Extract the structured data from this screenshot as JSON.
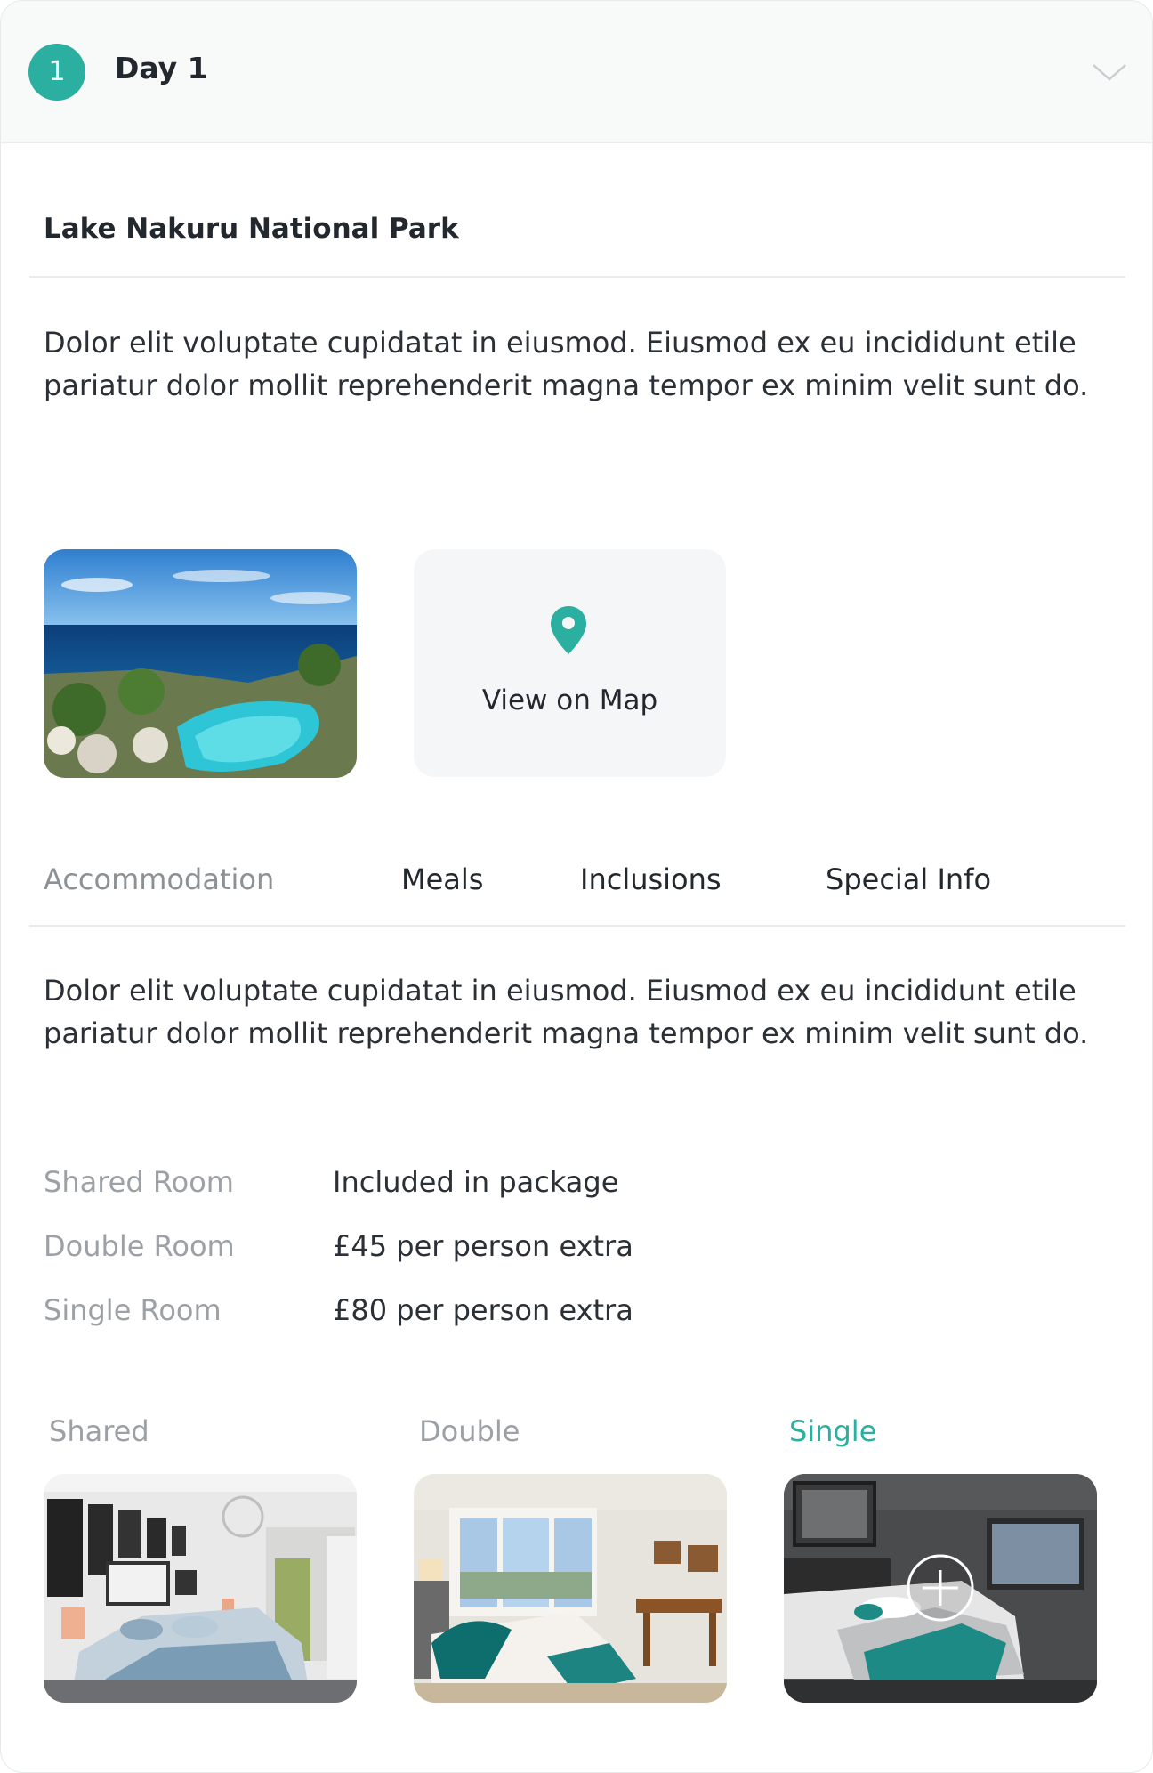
{
  "header": {
    "day_number": "1",
    "title": "Day 1"
  },
  "location": {
    "title": "Lake Nakuru National Park",
    "description": "Dolor elit voluptate cupidatat in eiusmod. Eiusmod ex eu incididunt etile pariatur dolor mollit reprehenderit magna tempor ex minim velit sunt do."
  },
  "map": {
    "label": "View on Map"
  },
  "tabs": [
    {
      "label": "Accommodation",
      "active": false
    },
    {
      "label": "Meals"
    },
    {
      "label": "Inclusions"
    },
    {
      "label": "Special Info"
    }
  ],
  "accommodation": {
    "description": "Dolor elit voluptate cupidatat in eiusmod. Eiusmod ex eu incididunt etile pariatur dolor mollit reprehenderit magna tempor ex minim velit sunt do.",
    "rooms": [
      {
        "label": "Shared Room",
        "value": "Included in package"
      },
      {
        "label": "Double Room",
        "value": "£45 per person extra"
      },
      {
        "label": "Single Room",
        "value": "£80 per person extra"
      }
    ],
    "room_types": [
      "Shared",
      "Double",
      "Single"
    ],
    "selected_room_type": "Single"
  },
  "colors": {
    "accent": "#2bafa0",
    "muted_text": "#9da1a6",
    "text": "#2b2f36"
  },
  "icons": {
    "map": "map-pin-icon",
    "collapse": "chevron-down-icon",
    "add": "plus-circle-icon"
  }
}
